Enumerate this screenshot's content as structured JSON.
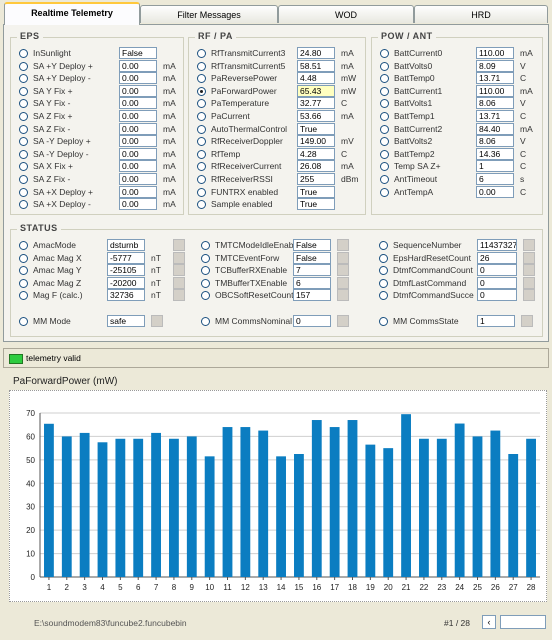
{
  "tabs": [
    "Realtime Telemetry",
    "Filter Messages",
    "WOD",
    "HRD"
  ],
  "eps": {
    "title": "EPS",
    "rows": [
      {
        "label": "InSunlight",
        "value": "False",
        "unit": ""
      },
      {
        "label": "SA +Y Deploy +",
        "value": "0.00",
        "unit": "mA"
      },
      {
        "label": "SA +Y Deploy -",
        "value": "0.00",
        "unit": "mA"
      },
      {
        "label": "SA Y Fix +",
        "value": "0.00",
        "unit": "mA"
      },
      {
        "label": "SA Y Fix -",
        "value": "0.00",
        "unit": "mA"
      },
      {
        "label": "SA Z Fix +",
        "value": "0.00",
        "unit": "mA"
      },
      {
        "label": "SA Z Fix -",
        "value": "0.00",
        "unit": "mA"
      },
      {
        "label": "SA -Y Deploy +",
        "value": "0.00",
        "unit": "mA"
      },
      {
        "label": "SA -Y Deploy -",
        "value": "0.00",
        "unit": "mA"
      },
      {
        "label": "SA X Fix +",
        "value": "0.00",
        "unit": "mA"
      },
      {
        "label": "SA Z Fix -",
        "value": "0.00",
        "unit": "mA"
      },
      {
        "label": "SA +X Deploy +",
        "value": "0.00",
        "unit": "mA"
      },
      {
        "label": "SA +X Deploy -",
        "value": "0.00",
        "unit": "mA"
      }
    ]
  },
  "rf": {
    "title": "RF / PA",
    "rows": [
      {
        "label": "RfTransmitCurrent3",
        "value": "24.80",
        "unit": "mA"
      },
      {
        "label": "RfTransmitCurrent5",
        "value": "58.51",
        "unit": "mA"
      },
      {
        "label": "PaReversePower",
        "value": "4.48",
        "unit": "mW"
      },
      {
        "label": "PaForwardPower",
        "value": "65.43",
        "unit": "mW"
      },
      {
        "label": "PaTemperature",
        "value": "32.77",
        "unit": "C"
      },
      {
        "label": "PaCurrent",
        "value": "53.66",
        "unit": "mA"
      },
      {
        "label": "AutoThermalControl",
        "value": "True",
        "unit": ""
      },
      {
        "label": "RfReceiverDoppler",
        "value": "149.00",
        "unit": "mV"
      },
      {
        "label": "RfTemp",
        "value": "4.28",
        "unit": "C"
      },
      {
        "label": "RfReceiverCurrent",
        "value": "26.08",
        "unit": "mA"
      },
      {
        "label": "RfReceiverRSSI",
        "value": "255",
        "unit": "dBm"
      },
      {
        "label": "FUNTRX enabled",
        "value": "True",
        "unit": ""
      },
      {
        "label": "Sample enabled",
        "value": "True",
        "unit": ""
      }
    ]
  },
  "pow": {
    "title": "POW / ANT",
    "rows": [
      {
        "label": "BattCurrent0",
        "value": "110.00",
        "unit": "mA"
      },
      {
        "label": "BattVolts0",
        "value": "8.09",
        "unit": "V"
      },
      {
        "label": "BattTemp0",
        "value": "13.71",
        "unit": "C"
      },
      {
        "label": "BattCurrent1",
        "value": "110.00",
        "unit": "mA"
      },
      {
        "label": "BattVolts1",
        "value": "8.06",
        "unit": "V"
      },
      {
        "label": "BattTemp1",
        "value": "13.71",
        "unit": "C"
      },
      {
        "label": "BattCurrent2",
        "value": "84.40",
        "unit": "mA"
      },
      {
        "label": "BattVolts2",
        "value": "8.06",
        "unit": "V"
      },
      {
        "label": "BattTemp2",
        "value": "14.36",
        "unit": "C"
      },
      {
        "label": "Temp SA Z+",
        "value": "1",
        "unit": "C"
      },
      {
        "label": "AntTimeout",
        "value": "6",
        "unit": "s"
      },
      {
        "label": "AntTempA",
        "value": "0.00",
        "unit": "C"
      }
    ]
  },
  "status": {
    "title": "STATUS",
    "col1": [
      {
        "label": "AmacMode",
        "value": "dsturnb",
        "unit": ""
      },
      {
        "label": "Amac Mag X",
        "value": "-5777",
        "unit": "nT"
      },
      {
        "label": "Amac Mag Y",
        "value": "-25105",
        "unit": "nT"
      },
      {
        "label": "Amac Mag Z",
        "value": "-20200",
        "unit": "nT"
      },
      {
        "label": "Mag F (calc.)",
        "value": "32736",
        "unit": "nT"
      }
    ],
    "col2": [
      {
        "label": "TMTCModeIdleEnab",
        "value": "False"
      },
      {
        "label": "TMTCEventForw",
        "value": "False"
      },
      {
        "label": "TCBufferRXEnable",
        "value": "7"
      },
      {
        "label": "TMBufferTXEnable",
        "value": "6"
      },
      {
        "label": "OBCSoftResetCount",
        "value": "157"
      }
    ],
    "col3": [
      {
        "label": "SequenceNumber",
        "value": "11437327"
      },
      {
        "label": "EpsHardResetCount",
        "value": "26"
      },
      {
        "label": "DtmfCommandCount",
        "value": "0"
      },
      {
        "label": "DtmfLastCommand",
        "value": "0"
      },
      {
        "label": "DtmfCommandSucce",
        "value": "0"
      }
    ],
    "mm": [
      {
        "label": "MM Mode",
        "value": "safe"
      },
      {
        "label": "MM CommsNominal",
        "value": "0"
      },
      {
        "label": "MM CommsState",
        "value": "1"
      }
    ]
  },
  "statusbar": {
    "telemetry_label": "telemetry valid",
    "led_color": "#2ecc40"
  },
  "chart_data": {
    "type": "bar",
    "title": "PaForwardPower (mW)",
    "categories": [
      "1",
      "2",
      "3",
      "4",
      "5",
      "6",
      "7",
      "8",
      "9",
      "10",
      "11",
      "12",
      "13",
      "14",
      "15",
      "16",
      "17",
      "18",
      "19",
      "20",
      "21",
      "22",
      "23",
      "24",
      "25",
      "26",
      "27",
      "28"
    ],
    "values": [
      65.4,
      60,
      61.5,
      57.5,
      59,
      59,
      61.5,
      59,
      60,
      51.5,
      64,
      64,
      62.5,
      51.5,
      52.5,
      67,
      64,
      67,
      56.5,
      55,
      69.5,
      59,
      59,
      65.5,
      60,
      62.5,
      52.5,
      59
    ],
    "ylim": [
      0,
      70
    ],
    "yticks": [
      0,
      10,
      20,
      30,
      40,
      50,
      60,
      70
    ],
    "grid": true,
    "bar_color": "#0b7dc1"
  },
  "footer": {
    "path": "E:\\soundmodem83\\funcube2.funcubebin",
    "page": "#1 / 28",
    "spin_glyph": "‹"
  }
}
